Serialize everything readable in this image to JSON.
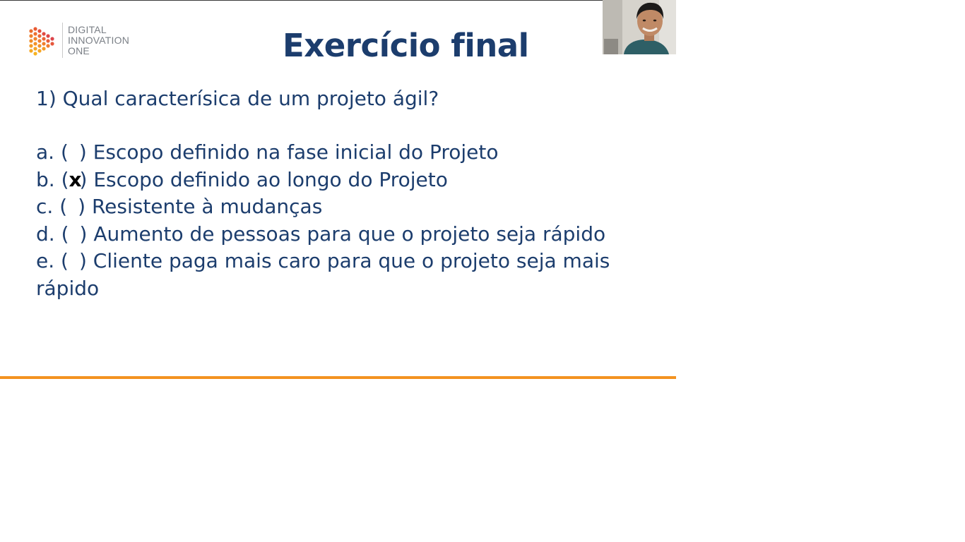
{
  "logo": {
    "lines": [
      "DIGITAL",
      "INNOVATION",
      "ONE"
    ]
  },
  "slide": {
    "title": "Exercício final",
    "question": "1) Qual caracterísica de um projeto ágil?",
    "options": [
      {
        "prefix": "a. (",
        "mark": "",
        "suffix": ") Escopo definido na fase inicial do Projeto"
      },
      {
        "prefix": "b. (",
        "mark": "x",
        "suffix": ") Escopo definido ao longo do Projeto"
      },
      {
        "prefix": "c. (",
        "mark": "",
        "suffix": ") Resistente à mudanças"
      },
      {
        "prefix": "d. (",
        "mark": "",
        "suffix": ") Aumento de pessoas para que o projeto seja rápido"
      },
      {
        "prefix": "e. (",
        "mark": "",
        "suffix": ") Cliente paga mais caro para que o projeto seja mais rápido"
      }
    ]
  },
  "colors": {
    "title": "#1c3d6d",
    "text": "#1c3d6d",
    "accent_line": "#f39220",
    "logo_text": "#7a7f86"
  },
  "icons": {
    "logo_mark": "digital-innovation-one-logo-icon",
    "webcam": "presenter-webcam"
  }
}
